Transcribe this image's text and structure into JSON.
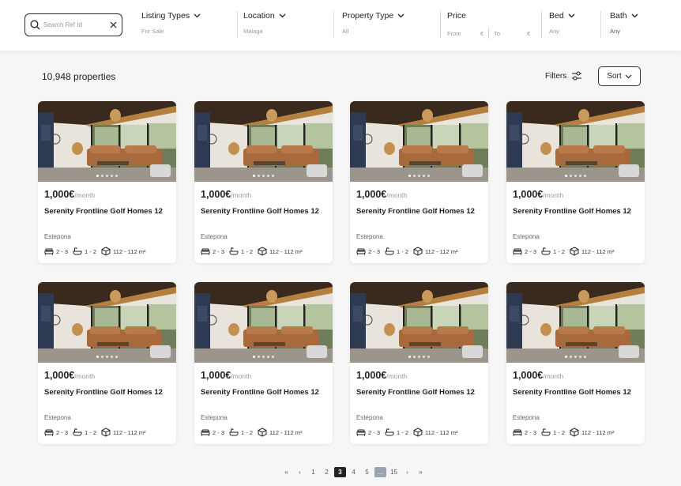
{
  "search": {
    "placeholder": "Search Ref Id"
  },
  "filters": {
    "listing_types": {
      "label": "Listing Types",
      "value": "For Sale"
    },
    "location": {
      "label": "Location",
      "value": "Málaga"
    },
    "property_type": {
      "label": "Property Type",
      "value": "All"
    },
    "price": {
      "label": "Price",
      "from_label": "From",
      "to_label": "To",
      "currency": "€"
    },
    "bed": {
      "label": "Bed",
      "value": "Any"
    },
    "bath": {
      "label": "Bath",
      "value": "Any"
    }
  },
  "results": {
    "count_text": "10,948 properties",
    "filters_label": "Filters",
    "sort_label": "Sort"
  },
  "listings": [
    {
      "price": "1,000€",
      "period": "/month",
      "title": "Serenity Frontline Golf Homes 12",
      "location": "Estepona",
      "beds": "2 - 3",
      "baths": "1 - 2",
      "area": "112 - 112 m²"
    },
    {
      "price": "1,000€",
      "period": "/month",
      "title": "Serenity Frontline Golf Homes 12",
      "location": "Estepona",
      "beds": "2 - 3",
      "baths": "1 - 2",
      "area": "112 - 112 m²"
    },
    {
      "price": "1,000€",
      "period": "/month",
      "title": "Serenity Frontline Golf Homes 12",
      "location": "Estepona",
      "beds": "2 - 3",
      "baths": "1 - 2",
      "area": "112 - 112 m²"
    },
    {
      "price": "1,000€",
      "period": "/month",
      "title": "Serenity Frontline Golf Homes 12",
      "location": "Estepona",
      "beds": "2 - 3",
      "baths": "1 - 2",
      "area": "112 - 112 m²"
    },
    {
      "price": "1,000€",
      "period": "/month",
      "title": "Serenity Frontline Golf Homes 12",
      "location": "Estepona",
      "beds": "2 - 3",
      "baths": "1 - 2",
      "area": "112 - 112 m²"
    },
    {
      "price": "1,000€",
      "period": "/month",
      "title": "Serenity Frontline Golf Homes 12",
      "location": "Estepona",
      "beds": "2 - 3",
      "baths": "1 - 2",
      "area": "112 - 112 m²"
    },
    {
      "price": "1,000€",
      "period": "/month",
      "title": "Serenity Frontline Golf Homes 12",
      "location": "Estepona",
      "beds": "2 - 3",
      "baths": "1 - 2",
      "area": "112 - 112 m²"
    },
    {
      "price": "1,000€",
      "period": "/month",
      "title": "Serenity Frontline Golf Homes 12",
      "location": "Estepona",
      "beds": "2 - 3",
      "baths": "1 - 2",
      "area": "112 - 112 m²"
    }
  ],
  "pagination": {
    "first": "«",
    "prev": "‹",
    "next": "›",
    "last": "»",
    "pages": [
      "1",
      "2",
      "3",
      "4",
      "5",
      "...",
      "15"
    ],
    "active": "3"
  }
}
